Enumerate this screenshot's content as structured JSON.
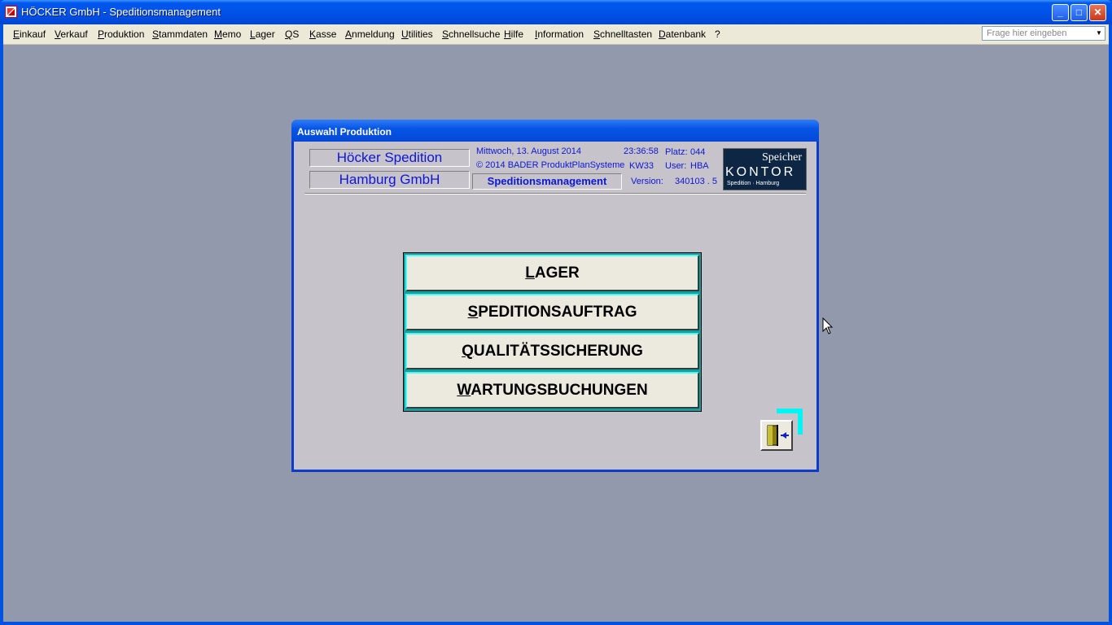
{
  "window": {
    "title": "HÖCKER GmbH - Speditionsmanagement",
    "buttons": {
      "minimize": "_",
      "maximize": "□",
      "close": "✕"
    }
  },
  "menubar": {
    "items": [
      "Einkauf",
      "Verkauf",
      "Produktion",
      "Stammdaten",
      "Memo",
      "Lager",
      "QS",
      "Kasse",
      "Anmeldung",
      "Utilities",
      "Schnellsuche",
      "Hilfe",
      "Information",
      "Schnelltasten",
      "Datenbank",
      "?"
    ],
    "help_placeholder": "Frage hier eingeben"
  },
  "dialog": {
    "title": "Auswahl Produktion",
    "header": {
      "company_line1": "Höcker Spedition",
      "company_line2": "Hamburg GmbH",
      "module": "Speditionsmanagement",
      "date": "Mittwoch, 13. August 2014",
      "time": "23:36:58",
      "platz_label": "Platz:",
      "platz_value": "044",
      "copyright": "© 2014 BADER ProduktPlanSysteme",
      "week": "KW33",
      "user_label": "User:",
      "user_value": "HBA",
      "version_label": "Version:",
      "version_value": "340103 . 5"
    },
    "logo": {
      "line1": "Speicher",
      "line2": "KONTOR",
      "line3": "Spedition · Hamburg"
    },
    "buttons": [
      "LAGER",
      "SPEDITIONSAUFTRAG",
      "QUALITÄTSSICHERUNG",
      "WARTUNGSBUCHUNGEN"
    ],
    "exit_icon": "exit-door-icon"
  }
}
